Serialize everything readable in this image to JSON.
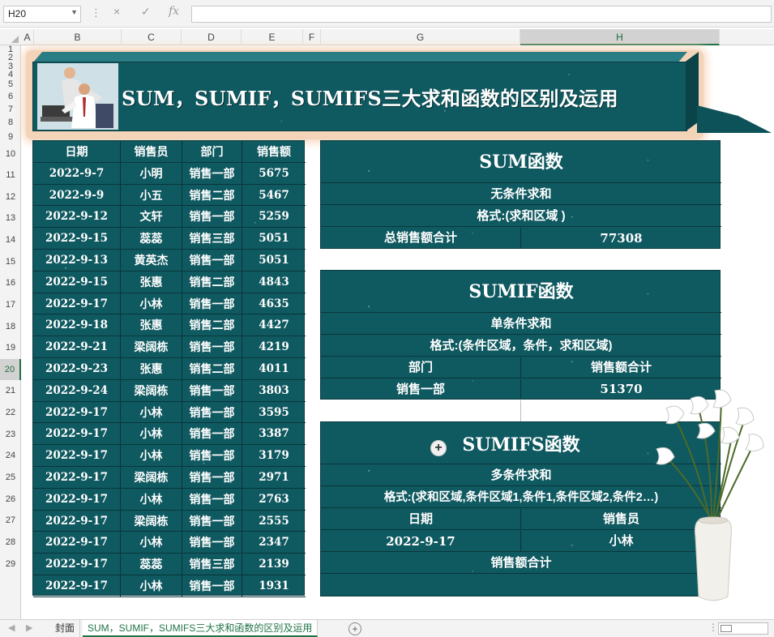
{
  "formula_bar": {
    "name_box": "H20",
    "cancel_icon": "×",
    "enter_icon": "✓",
    "fx_label": "fx",
    "formula": ""
  },
  "columns": [
    "A",
    "B",
    "C",
    "D",
    "E",
    "F",
    "G",
    "H"
  ],
  "selected_column": "H",
  "rows": [
    "1",
    "2",
    "3",
    "4",
    "5",
    "6",
    "7",
    "8",
    "9",
    "10",
    "11",
    "12",
    "13",
    "14",
    "15",
    "16",
    "17",
    "18",
    "19",
    "20",
    "21",
    "22",
    "23",
    "24",
    "25",
    "26",
    "27",
    "28",
    "29"
  ],
  "selected_row": "20",
  "banner": {
    "title": "SUM，SUMIF，SUMIFS三大求和函数的区别及运用"
  },
  "sales_table": {
    "headers": [
      "日期",
      "销售员",
      "部门",
      "销售额"
    ],
    "rows": [
      [
        "2022-9-7",
        "小明",
        "销售一部",
        "5675"
      ],
      [
        "2022-9-9",
        "小五",
        "销售二部",
        "5467"
      ],
      [
        "2022-9-12",
        "文轩",
        "销售一部",
        "5259"
      ],
      [
        "2022-9-15",
        "蕊蕊",
        "销售三部",
        "5051"
      ],
      [
        "2022-9-13",
        "黄英杰",
        "销售一部",
        "5051"
      ],
      [
        "2022-9-15",
        "张惠",
        "销售二部",
        "4843"
      ],
      [
        "2022-9-17",
        "小林",
        "销售一部",
        "4635"
      ],
      [
        "2022-9-18",
        "张惠",
        "销售二部",
        "4427"
      ],
      [
        "2022-9-21",
        "梁阔栋",
        "销售一部",
        "4219"
      ],
      [
        "2022-9-23",
        "张惠",
        "销售二部",
        "4011"
      ],
      [
        "2022-9-24",
        "梁阔栋",
        "销售一部",
        "3803"
      ],
      [
        "2022-9-17",
        "小林",
        "销售一部",
        "3595"
      ],
      [
        "2022-9-17",
        "小林",
        "销售一部",
        "3387"
      ],
      [
        "2022-9-17",
        "小林",
        "销售一部",
        "3179"
      ],
      [
        "2022-9-17",
        "梁阔栋",
        "销售一部",
        "2971"
      ],
      [
        "2022-9-17",
        "小林",
        "销售一部",
        "2763"
      ],
      [
        "2022-9-17",
        "梁阔栋",
        "销售一部",
        "2555"
      ],
      [
        "2022-9-17",
        "小林",
        "销售一部",
        "2347"
      ],
      [
        "2022-9-17",
        "蕊蕊",
        "销售三部",
        "2139"
      ],
      [
        "2022-9-17",
        "小林",
        "销售一部",
        "1931"
      ]
    ]
  },
  "sum_box": {
    "title": "SUM函数",
    "desc": "无条件求和",
    "format": "格式:(求和区域 )",
    "total_label": "总销售额合计",
    "total_value": "77308"
  },
  "sumif_box": {
    "title": "SUMIF函数",
    "desc": "单条件求和",
    "format": "格式:(条件区域，条件，求和区域)",
    "col1_header": "部门",
    "col2_header": "销售额合计",
    "col1_value": "销售一部",
    "col2_value": "51370"
  },
  "sumifs_box": {
    "title": "SUMIFS函数",
    "desc": "多条件求和",
    "format": "格式:(求和区域,条件区域1,条件1,条件区域2,条件2…)",
    "col1_header": "日期",
    "col2_header": "销售员",
    "col1_value": "2022-9-17",
    "col2_value": "小林",
    "total_label": "销售额合计",
    "total_value": ""
  },
  "sheet_tabs": {
    "tabs": [
      "封面",
      "SUM，SUMIF，SUMIFS三大求和函数的区别及运用"
    ],
    "active_index": 1,
    "add_icon": "+"
  }
}
